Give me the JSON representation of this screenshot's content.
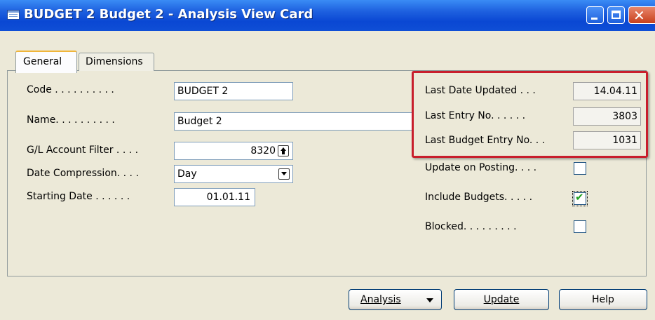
{
  "window": {
    "title": "BUDGET 2 Budget 2 - Analysis View Card",
    "icon": "table-icon",
    "controls": [
      "minimize-icon",
      "maximize-icon",
      "close-icon"
    ]
  },
  "tabs": [
    {
      "label": "General",
      "active": true
    },
    {
      "label": "Dimensions",
      "active": false
    }
  ],
  "general": {
    "code": {
      "label": "Code . . . . . . . . . .",
      "value": "BUDGET 2"
    },
    "name": {
      "label": "Name. . . . . . . . . .",
      "value": "Budget 2"
    },
    "gl_filter": {
      "label": "G/L Account Filter . . . .",
      "value": "8320",
      "button_icon": "lookup-arrow-up-icon"
    },
    "date_compression": {
      "label": "Date Compression. . . .",
      "value": "Day",
      "button_icon": "dropdown-arrow-icon"
    },
    "starting_date": {
      "label": "Starting Date . . . . . .",
      "value": "01.01.11"
    }
  },
  "stats": {
    "last_date_updated": {
      "label": "Last Date Updated . . .",
      "value": "14.04.11"
    },
    "last_entry_no": {
      "label": "Last Entry No. . . . . .",
      "value": "3803"
    },
    "last_budget_entry_no": {
      "label": "Last Budget Entry No. . .",
      "value": "1031"
    }
  },
  "options": {
    "update_on_posting": {
      "label": "Update on Posting. . . .",
      "checked": false
    },
    "include_budgets": {
      "label": "Include Budgets. . . . .",
      "checked": true,
      "mark": "✔"
    },
    "blocked": {
      "label": "Blocked. . . . . . . . .",
      "checked": false
    }
  },
  "buttons": {
    "analysis": "Analysis",
    "update": "Update",
    "help": "Help"
  },
  "colors": {
    "highlight_border": "#c81e2c",
    "titlebar": "#0a47d3",
    "check_mark": "#21a121"
  }
}
